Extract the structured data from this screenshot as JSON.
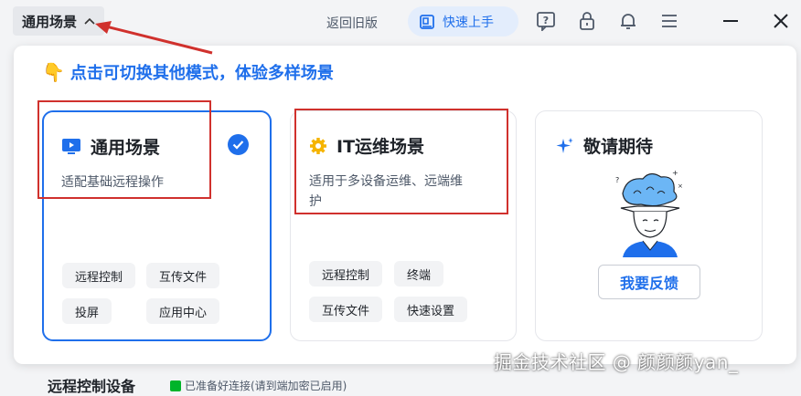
{
  "topbar": {
    "mode_label": "通用场景",
    "old_version": "返回旧版",
    "quick_start": "快速上手"
  },
  "hint": "点击可切换其他模式，体验多样场景",
  "cards": [
    {
      "title": "通用场景",
      "desc": "适配基础远程操作",
      "chips": [
        "远程控制",
        "互传文件",
        "投屏",
        "应用中心"
      ],
      "selected": true
    },
    {
      "title": "IT运维场景",
      "desc_line1": "适用于多设备运维、远端维",
      "desc_line2": "护",
      "chips": [
        "远程控制",
        "终端",
        "互传文件",
        "快速设置"
      ]
    },
    {
      "title": "敬请期待",
      "button": "我要反馈"
    }
  ],
  "bottom": {
    "title": "远程控制设备",
    "sub": "已准备好连接(请到端加密已启用)"
  },
  "watermark": "掘金技术社区 @ 颜颜颜yan_",
  "colors": {
    "accent": "#1f6feb",
    "annotation": "#d0312d"
  }
}
